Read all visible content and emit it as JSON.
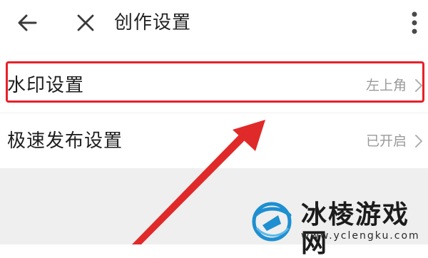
{
  "header": {
    "title": "创作设置",
    "back_icon": "arrow-left-icon",
    "close_icon": "close-icon",
    "more_icon": "more-vertical-icon"
  },
  "settings": [
    {
      "label": "水印设置",
      "value": "左上角",
      "highlighted": true
    },
    {
      "label": "极速发布设置",
      "value": "已开启",
      "highlighted": false
    }
  ],
  "watermark": {
    "title": "冰棱游戏网",
    "url": "www.yclengku.com"
  },
  "colors": {
    "highlight": "#e8202a",
    "arrow": "#e02a2a",
    "logo_blue": "#1e8fd0",
    "value_text": "#9a9a9a",
    "grey_area": "#efefef"
  }
}
